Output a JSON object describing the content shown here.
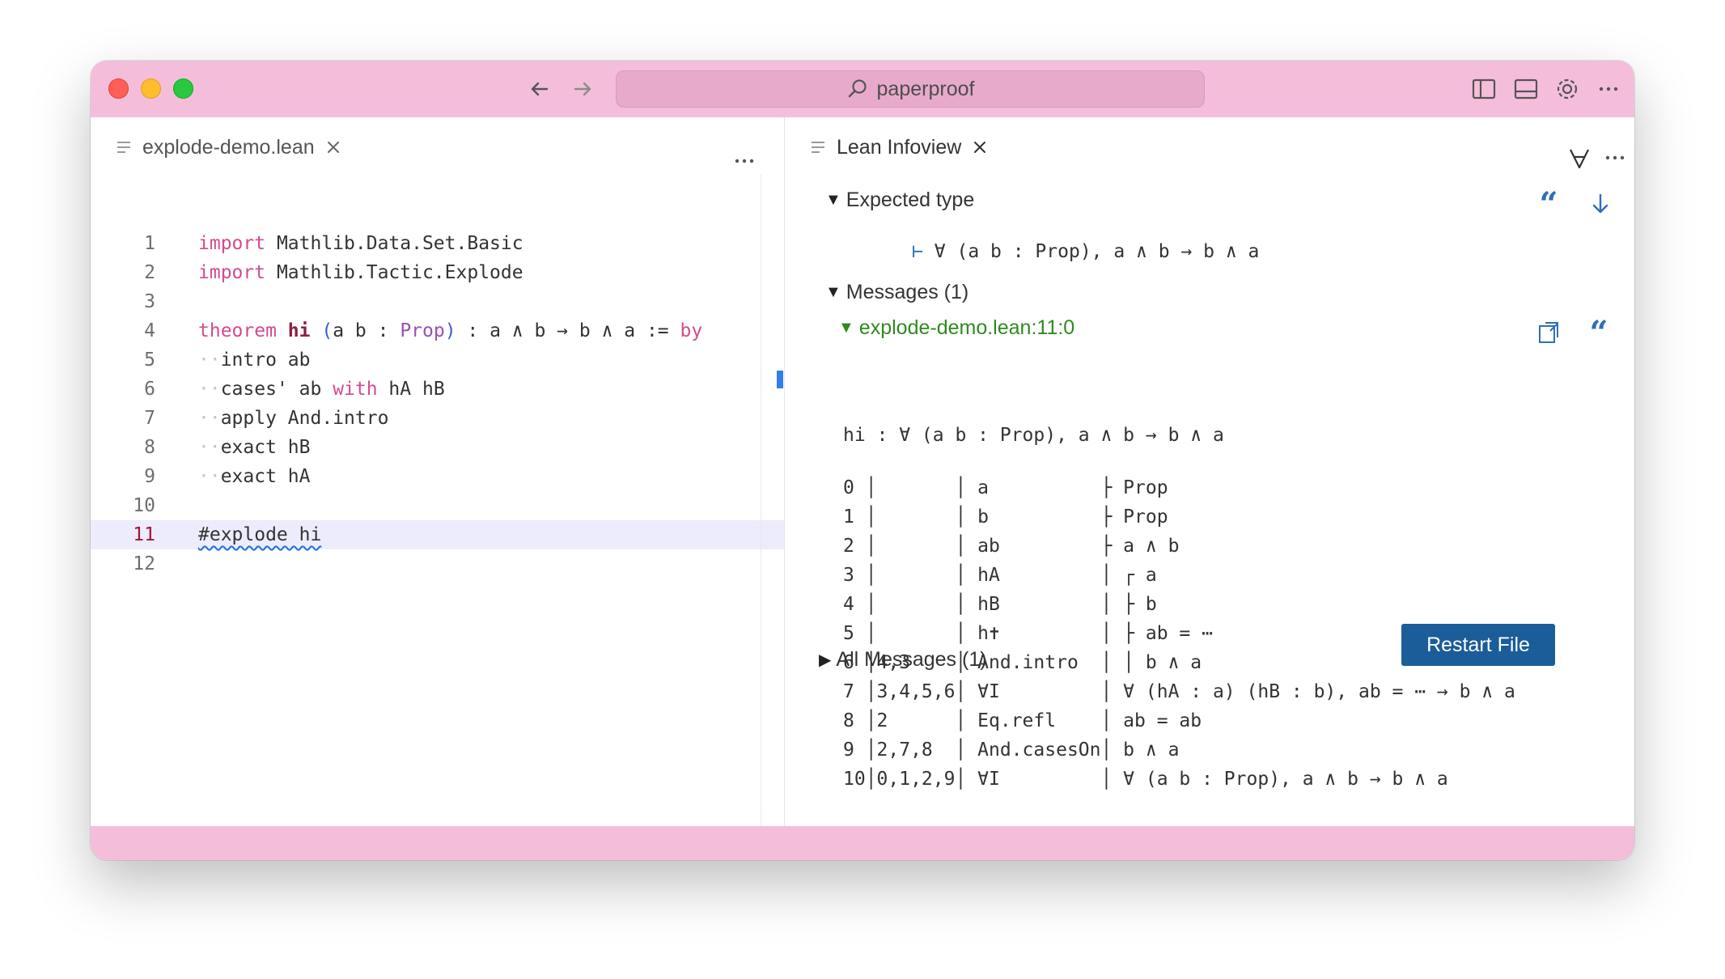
{
  "titlebar": {
    "search_text": "paperproof"
  },
  "editor": {
    "tab_label": "explode-demo.lean",
    "lines": [
      {
        "num": "1",
        "parts": [
          {
            "t": "import",
            "c": "kw"
          },
          {
            "t": " Mathlib.Data.Set.Basic",
            "c": ""
          }
        ]
      },
      {
        "num": "2",
        "parts": [
          {
            "t": "import",
            "c": "kw"
          },
          {
            "t": " Mathlib.Tactic.Explode",
            "c": ""
          }
        ]
      },
      {
        "num": "3",
        "parts": []
      },
      {
        "num": "4",
        "parts": [
          {
            "t": "theorem",
            "c": "kw"
          },
          {
            "t": " ",
            "c": ""
          },
          {
            "t": "hi",
            "c": "bold"
          },
          {
            "t": " ",
            "c": ""
          },
          {
            "t": "(",
            "c": "paren"
          },
          {
            "t": "a b : ",
            "c": ""
          },
          {
            "t": "Prop",
            "c": "type"
          },
          {
            "t": ")",
            "c": "paren"
          },
          {
            "t": " : a ∧ b → b ∧ a := ",
            "c": ""
          },
          {
            "t": "by",
            "c": "kw"
          }
        ]
      },
      {
        "num": "5",
        "parts": [
          {
            "t": "··",
            "c": "dots"
          },
          {
            "t": "intro ab",
            "c": ""
          }
        ]
      },
      {
        "num": "6",
        "parts": [
          {
            "t": "··",
            "c": "dots"
          },
          {
            "t": "cases' ab ",
            "c": ""
          },
          {
            "t": "with",
            "c": "kw"
          },
          {
            "t": " hA hB",
            "c": ""
          }
        ]
      },
      {
        "num": "7",
        "parts": [
          {
            "t": "··",
            "c": "dots"
          },
          {
            "t": "apply And.intro",
            "c": ""
          }
        ]
      },
      {
        "num": "8",
        "parts": [
          {
            "t": "··",
            "c": "dots"
          },
          {
            "t": "exact hB",
            "c": ""
          }
        ]
      },
      {
        "num": "9",
        "parts": [
          {
            "t": "··",
            "c": "dots"
          },
          {
            "t": "exact hA",
            "c": ""
          }
        ]
      },
      {
        "num": "10",
        "parts": []
      },
      {
        "num": "11",
        "parts": [
          {
            "t": "#explode hi",
            "c": "squig"
          }
        ],
        "current": true
      },
      {
        "num": "12",
        "parts": []
      }
    ]
  },
  "infoview": {
    "tab_label": "Lean Infoview",
    "expected_type": {
      "heading": "Expected type",
      "turnstile": "⊢",
      "goal": " ∀ (a b : Prop), a ∧ b → b ∧ a"
    },
    "messages": {
      "heading": "Messages (1)",
      "file_ref": "explode-demo.lean:11:0",
      "signature": "hi : ∀ (a b : Prop), a ∧ b → b ∧ a",
      "table": [
        "0 │       │ a          ├ Prop",
        "1 │       │ b          ├ Prop",
        "2 │       │ ab         ├ a ∧ b",
        "3 │       │ hA         │ ┌ a",
        "4 │       │ hB         │ ├ b",
        "5 │       │ h✝         │ ├ ab = ⋯",
        "6 │4,3    │ And.intro  │ │ b ∧ a",
        "7 │3,4,5,6│ ∀I         │ ∀ (hA : a) (hB : b), ab = ⋯ → b ∧ a",
        "8 │2      │ Eq.refl    │ ab = ab",
        "9 │2,7,8  │ And.casesOn│ b ∧ a",
        "10│0,1,2,9│ ∀I         │ ∀ (a b : Prop), a ∧ b → b ∧ a"
      ]
    },
    "all_messages": "All Messages (1)",
    "restart_label": "Restart File"
  },
  "colors": {
    "titlebar": "#f4bedb",
    "accent": "#1a5d99",
    "keyword": "#d44a8f",
    "icon_blue": "#2f6fb5"
  }
}
